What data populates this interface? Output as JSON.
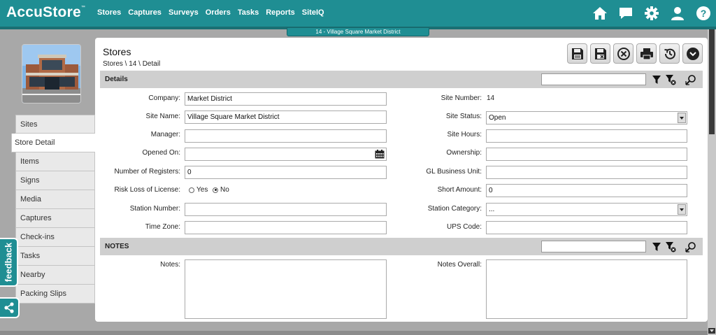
{
  "app": {
    "logo": "AccuStore",
    "logo_tm": "™",
    "nav": [
      "Stores",
      "Captures",
      "Surveys",
      "Orders",
      "Tasks",
      "Reports",
      "SiteIQ"
    ],
    "top_icons": [
      "home-icon",
      "chat-icon",
      "gear-icon",
      "user-icon",
      "help-icon"
    ],
    "record_tab": "14 - Village Square Market District",
    "accent_color": "#1f8e93"
  },
  "page": {
    "title": "Stores",
    "breadcrumb": "Stores \\ 14 \\ Detail",
    "toolbar_icons": [
      "save-icon",
      "save-close-icon",
      "cancel-icon",
      "print-icon",
      "history-icon",
      "more-icon"
    ]
  },
  "sidebar": {
    "items": [
      "Sites",
      "Store Detail",
      "Items",
      "Signs",
      "Media",
      "Captures",
      "Check-ins",
      "Tasks",
      "Nearby",
      "Packing Slips"
    ],
    "active": "Store Detail"
  },
  "feedback_label": "feedback",
  "details": {
    "section_title": "Details",
    "company_label": "Company:",
    "company_value": "Market District",
    "site_name_label": "Site Name:",
    "site_name_value": "Village Square Market District",
    "manager_label": "Manager:",
    "manager_value": "",
    "opened_on_label": "Opened On:",
    "opened_on_value": "",
    "registers_label": "Number of Registers:",
    "registers_value": "0",
    "risk_label": "Risk Loss of License:",
    "risk_yes": "Yes",
    "risk_no": "No",
    "risk_selected": "No",
    "station_number_label": "Station Number:",
    "station_number_value": "",
    "time_zone_label": "Time Zone:",
    "time_zone_value": "",
    "site_number_label": "Site Number:",
    "site_number_value": "14",
    "site_status_label": "Site Status:",
    "site_status_value": "Open",
    "site_hours_label": "Site Hours:",
    "site_hours_value": "",
    "ownership_label": "Ownership:",
    "ownership_value": "",
    "gl_label": "GL Business Unit:",
    "gl_value": "",
    "short_amount_label": "Short Amount:",
    "short_amount_value": "0",
    "station_category_label": "Station Category:",
    "station_category_value": "...",
    "ups_label": "UPS Code:",
    "ups_value": ""
  },
  "notes": {
    "section_title": "NOTES",
    "notes_label": "Notes:",
    "notes_value": "",
    "notes_overall_label": "Notes Overall:",
    "notes_overall_value": ""
  }
}
